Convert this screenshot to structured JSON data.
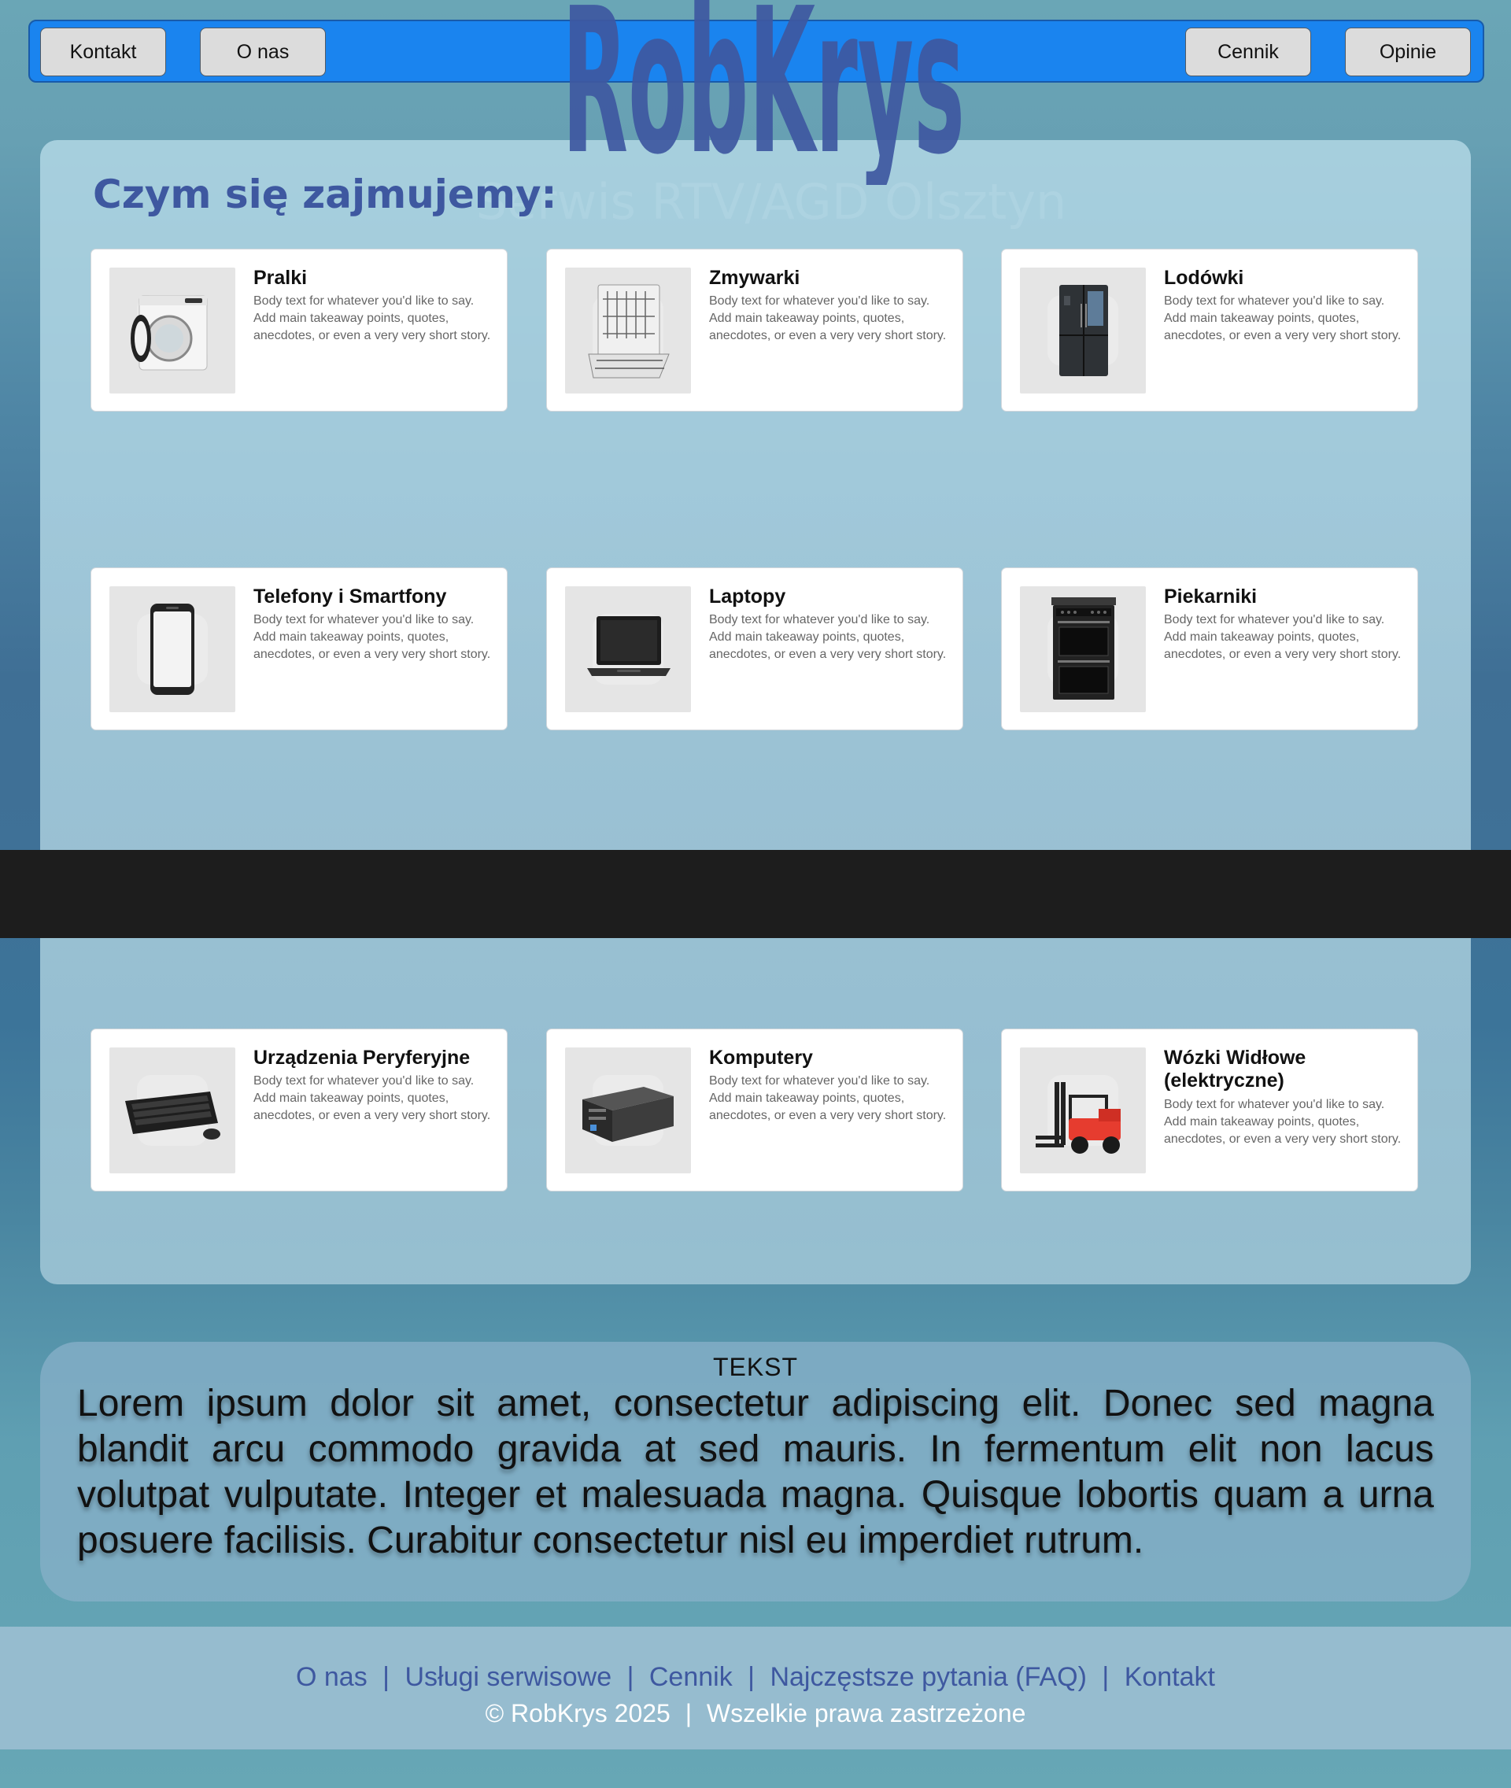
{
  "header": {
    "nav_left": [
      "Kontakt",
      "O nas"
    ],
    "nav_right": [
      "Cennik",
      "Opinie"
    ],
    "logo_text": "RobKrys",
    "subtitle": "Serwis RTV/AGD Olsztyn"
  },
  "services": {
    "title": "Czym się zajmujemy:",
    "cards": [
      {
        "title": "Pralki",
        "body": "Body text for whatever you'd like to say. Add main takeaway points, quotes, anecdotes, or even a very very short story.",
        "icon": "washing-machine-icon"
      },
      {
        "title": "Zmywarki",
        "body": "Body text for whatever you'd like to say. Add main takeaway points, quotes, anecdotes, or even a very very short story.",
        "icon": "dishwasher-icon"
      },
      {
        "title": "Lodówki",
        "body": "Body text for whatever you'd like to say. Add main takeaway points, quotes, anecdotes, or even a very very short story.",
        "icon": "fridge-icon"
      },
      {
        "title": "Telefony i Smartfony",
        "body": "Body text for whatever you'd like to say. Add main takeaway points, quotes, anecdotes, or even a very very short story.",
        "icon": "smartphone-icon"
      },
      {
        "title": "Laptopy",
        "body": "Body text for whatever you'd like to say. Add main takeaway points, quotes, anecdotes, or even a very very short story.",
        "icon": "laptop-icon"
      },
      {
        "title": "Piekarniki",
        "body": "Body text for whatever you'd like to say. Add main takeaway points, quotes, anecdotes, or even a very very short story.",
        "icon": "oven-icon"
      },
      {
        "title": "Urządzenia Peryferyjne",
        "body": "Body text for whatever you'd like to say. Add main takeaway points, quotes, anecdotes, or even a very very short story.",
        "icon": "keyboard-icon"
      },
      {
        "title": "Komputery",
        "body": "Body text for whatever you'd like to say. Add main takeaway points, quotes, anecdotes, or even a very very short story.",
        "icon": "desktop-computer-icon"
      },
      {
        "title": "Wózki Widłowe (elektryczne)",
        "body": "Body text for whatever you'd like to say. Add main takeaway points, quotes, anecdotes, or even a very very short story.",
        "icon": "forklift-icon"
      }
    ]
  },
  "text_section": {
    "label": "TEKST",
    "body": "Lorem ipsum dolor sit amet, consectetur adipiscing elit. Donec sed magna blandit arcu commodo gravida at sed mauris. In fermentum elit non lacus volutpat vulputate. Integer et malesuada magna. Quisque lobortis quam a urna posuere facilisis. Curabitur consectetur nisl eu imperdiet rutrum."
  },
  "footer": {
    "links": [
      "O nas",
      "Usługi serwisowe",
      "Cennik",
      "Najczęstsze pytania (FAQ)",
      "Kontakt"
    ],
    "copyright": "© RobKrys 2025",
    "rights": "Wszelkie prawa zastrzeżone"
  },
  "colors": {
    "header_bar": "#1a84ef",
    "logo": "#3e58a0",
    "link": "#3e58a0",
    "dark_strip": "#1d1d1d",
    "accent_red": "#e63c2f"
  }
}
